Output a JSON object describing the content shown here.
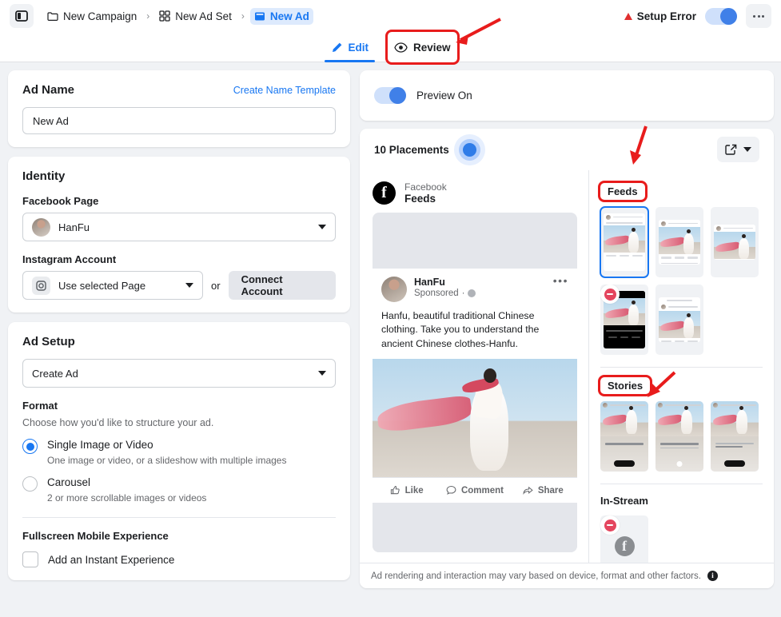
{
  "topbar": {
    "panel_toggle_icon": "sidebar-panel-icon",
    "breadcrumbs": [
      {
        "label": "New Campaign",
        "icon": "folder-icon",
        "active": false
      },
      {
        "label": "New Ad Set",
        "icon": "grid-icon",
        "active": false
      },
      {
        "label": "New Ad",
        "icon": "ad-icon",
        "active": true
      }
    ],
    "separator": "›",
    "status_label": "Setup Error",
    "status_color": "#e02f2f",
    "toggle_on": true,
    "more_icon": "more-horizontal-icon"
  },
  "tabs": [
    {
      "label": "Edit",
      "icon": "pencil-icon",
      "active": true
    },
    {
      "label": "Review",
      "icon": "eye-icon",
      "active": false,
      "highlighted": true
    }
  ],
  "ad_name": {
    "title": "Ad Name",
    "template_link": "Create Name Template",
    "value": "New Ad",
    "placeholder": "Ad name"
  },
  "identity": {
    "title": "Identity",
    "facebook_page_label": "Facebook Page",
    "facebook_page_value": "HanFu",
    "instagram_label": "Instagram Account",
    "instagram_value": "Use selected Page",
    "or_text": "or",
    "connect_button": "Connect Account"
  },
  "ad_setup": {
    "title": "Ad Setup",
    "create_value": "Create Ad",
    "format_label": "Format",
    "format_desc": "Choose how you'd like to structure your ad.",
    "options": [
      {
        "label": "Single Image or Video",
        "desc": "One image or video, or a slideshow with multiple images",
        "selected": true
      },
      {
        "label": "Carousel",
        "desc": "2 or more scrollable images or videos",
        "selected": false
      }
    ],
    "fullscreen_label": "Fullscreen Mobile Experience",
    "instant_label": "Add an Instant Experience",
    "instant_checked": false
  },
  "preview": {
    "toggle_label": "Preview On",
    "toggle_on": true,
    "placements_label": "10 Placements",
    "expand_icon": "external-link-icon",
    "expand_caret_icon": "chevron-down-icon",
    "platform": "Facebook",
    "placement": "Feeds",
    "ad": {
      "page_name": "HanFu",
      "sponsored": "Sponsored",
      "globe_icon": "globe-icon",
      "more_icon": "more-horizontal-icon",
      "copy": "Hanfu, beautiful traditional Chinese clothing. Take you to understand the ancient Chinese clothes-Hanfu.",
      "actions": [
        {
          "label": "Like",
          "icon": "thumbs-up-icon"
        },
        {
          "label": "Comment",
          "icon": "comment-icon"
        },
        {
          "label": "Share",
          "icon": "share-icon"
        }
      ]
    },
    "sections": [
      {
        "title": "Feeds",
        "highlighted": true,
        "thumbs": [
          {
            "kind": "feed",
            "selected": true,
            "error": false,
            "offset": "top"
          },
          {
            "kind": "feed",
            "selected": false,
            "error": false,
            "offset": "mid"
          },
          {
            "kind": "feed",
            "selected": false,
            "error": false,
            "offset": "low"
          },
          {
            "kind": "video",
            "selected": false,
            "error": true,
            "offset": "top"
          },
          {
            "kind": "feed",
            "selected": false,
            "error": false,
            "offset": "mid"
          }
        ]
      },
      {
        "title": "Stories",
        "highlighted": true,
        "stories": [
          {
            "cta": "bar"
          },
          {
            "cta": "circle"
          },
          {
            "cta": "bar"
          }
        ]
      },
      {
        "title": "In-Stream",
        "highlighted": false,
        "instream": [
          {
            "error": true,
            "icon": "facebook-icon"
          }
        ]
      }
    ],
    "footer_note": "Ad rendering and interaction may vary based on device, format and other factors.",
    "footer_info_icon": "info-icon"
  },
  "annotations": {
    "color": "#e81c1c",
    "targets": [
      "Review",
      "Feeds",
      "Stories"
    ]
  }
}
